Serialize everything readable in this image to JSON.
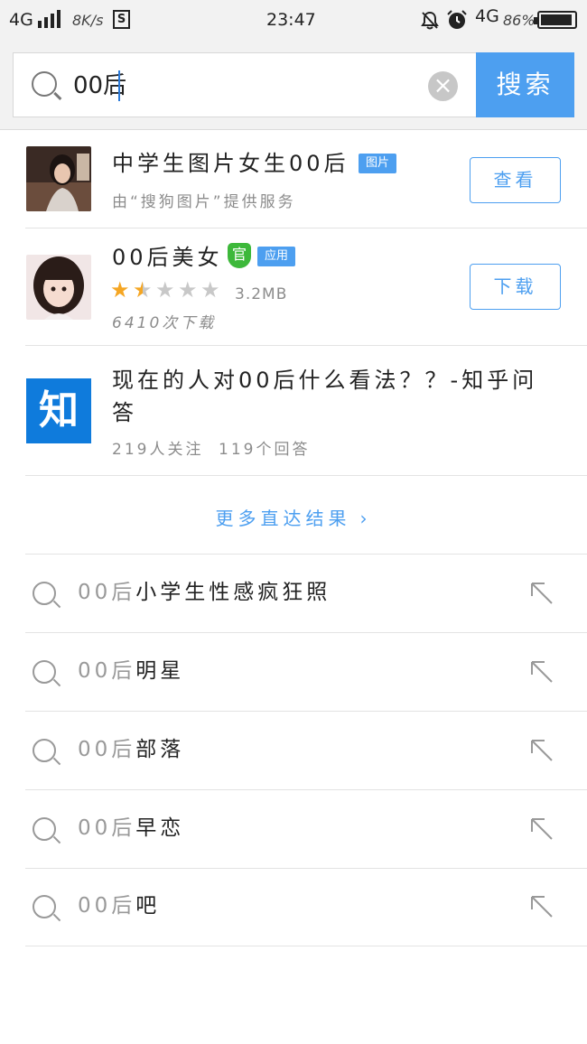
{
  "status_bar": {
    "network_left": "4G",
    "speed": "8K/s",
    "sim": "S",
    "time": "23:47",
    "network_right": "4G",
    "battery": "86%"
  },
  "search": {
    "query": "00后",
    "button_label": "搜索"
  },
  "results": [
    {
      "title": "中学生图片女生00后",
      "tag": "图片",
      "subtitle": "由“搜狗图片”提供服务",
      "action": "查看"
    },
    {
      "title": "00后美女",
      "official_badge": "官",
      "tag": "应用",
      "rating": 1.5,
      "rating_max": 5,
      "size": "3.2MB",
      "downloads": "6410次下载",
      "action": "下载"
    },
    {
      "logo_text": "知",
      "title_line1": "现在的人对00后什么看法？？-知乎问",
      "title_line2": "答",
      "followers": "219人关注",
      "answers": "119个回答"
    }
  ],
  "more_results": "更多直达结果",
  "suggestions": [
    {
      "keyword": "00后",
      "rest": "小学生性感疯狂照"
    },
    {
      "keyword": "00后",
      "rest": "明星"
    },
    {
      "keyword": "00后",
      "rest": "部落"
    },
    {
      "keyword": "00后",
      "rest": "早恋"
    },
    {
      "keyword": "00后",
      "rest": "吧"
    }
  ],
  "colors": {
    "accent": "#4d9ff0",
    "star": "#f5a623",
    "official": "#3db83a",
    "zhihu": "#0f7bdc"
  }
}
